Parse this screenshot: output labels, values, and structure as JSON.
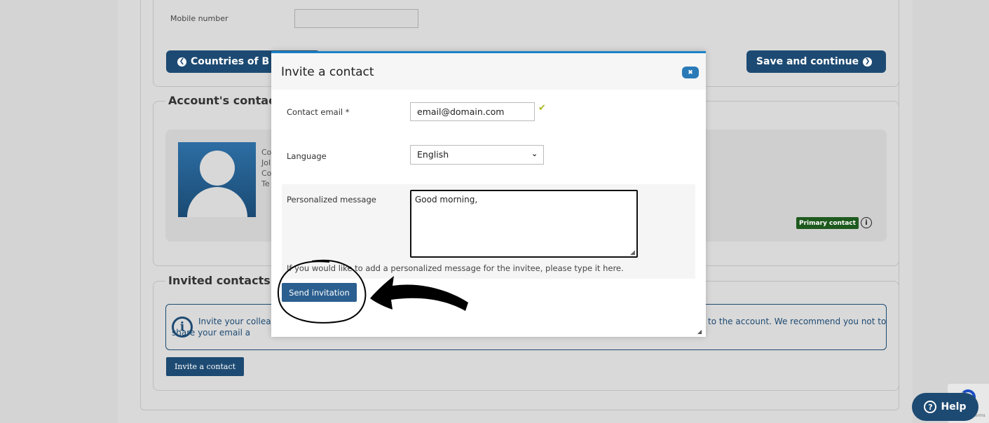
{
  "background": {
    "mobile_label": "Mobile number",
    "countries_button": "Countries of B",
    "save_button": "Save and continue",
    "accounts_contacts_legend": "Account's contac",
    "card_lines": [
      "Co",
      "Jol",
      "Co",
      "Te"
    ],
    "primary_badge": "Primary contact",
    "invited_legend": "Invited contacts",
    "info_text_line1": "Invite your collea",
    "info_text_line2": "share your email a",
    "info_text_right": "to the account. We recommend you not to",
    "invite_contact_button": "Invite a contact",
    "recaptcha_terms": "Terms",
    "help_button": "Help"
  },
  "modal": {
    "title": "Invite a contact",
    "close_glyph": "✖",
    "email_label": "Contact email *",
    "email_value": "email@domain.com",
    "language_label": "Language",
    "language_selected": "English",
    "message_label": "Personalized message",
    "message_value": "Good morning,",
    "message_hint": "If you would like to add a personalized message for the invitee, please type it here.",
    "send_button": "Send invitation"
  },
  "colors": {
    "brand_dark": "#1d4a72",
    "modal_accent": "#1b82c7",
    "primary_badge": "#1e5a1e",
    "check": "#a8b820"
  }
}
